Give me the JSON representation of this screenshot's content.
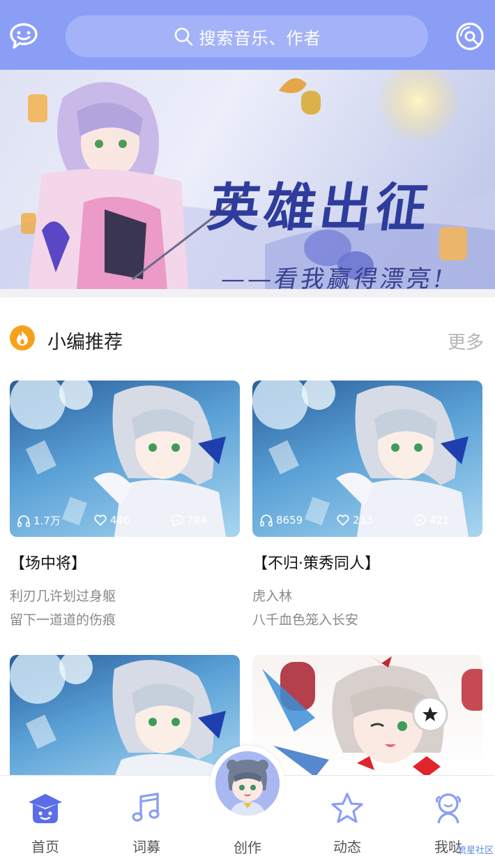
{
  "header": {
    "search_placeholder": "搜索音乐、作者",
    "left_icon": "chat-bubble-icon",
    "right_icon": "music-disc-icon",
    "bg_color": "#8b9ef6"
  },
  "banner": {
    "title": "英雄出征",
    "subtitle": "——看我赢得漂亮!",
    "slides": 3,
    "active_slide": 0
  },
  "section": {
    "icon": "fire-icon",
    "title": "小编推荐",
    "more_label": "更多"
  },
  "cards": [
    {
      "title": "【场中将】",
      "line1": "利刃几许划过身躯",
      "line2": "留下一道道的伤痕",
      "plays": "1.7万",
      "likes": "446",
      "comments": "794"
    },
    {
      "title": "【不归·策秀同人】",
      "line1": "虎入林",
      "line2": "八千血色笼入长安",
      "plays": "8659",
      "likes": "233",
      "comments": "421"
    }
  ],
  "tabbar": {
    "tabs": [
      {
        "label": "首页",
        "icon": "home-face-icon",
        "active": true
      },
      {
        "label": "词募",
        "icon": "music-note-icon",
        "active": false
      },
      {
        "label": "创作",
        "icon": "avatar-icon",
        "active": false
      },
      {
        "label": "动态",
        "icon": "star-icon",
        "active": false
      },
      {
        "label": "我哒",
        "icon": "profile-icon",
        "active": false
      }
    ],
    "accent": "#5b6ee8"
  },
  "watermark": "流星社区"
}
